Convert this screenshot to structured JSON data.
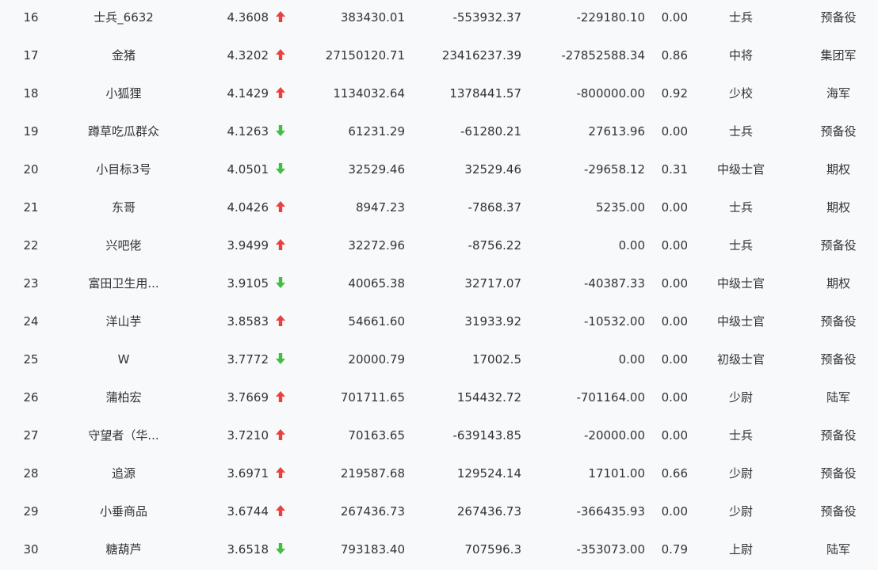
{
  "colors": {
    "up": "#e8423f",
    "down": "#3fbf3f",
    "text": "#333333",
    "background": "#f8f9fb"
  },
  "rows": [
    {
      "rank": "16",
      "name": "士兵_6632",
      "score": "4.3608",
      "trend": "up",
      "v1": "383430.01",
      "v2": "-553932.37",
      "v3": "-229180.10",
      "ratio": "0.00",
      "level": "士兵",
      "category": "预备役"
    },
    {
      "rank": "17",
      "name": "金猪",
      "score": "4.3202",
      "trend": "up",
      "v1": "27150120.71",
      "v2": "23416237.39",
      "v3": "-27852588.34",
      "ratio": "0.86",
      "level": "中将",
      "category": "集团军"
    },
    {
      "rank": "18",
      "name": "小狐狸",
      "score": "4.1429",
      "trend": "up",
      "v1": "1134032.64",
      "v2": "1378441.57",
      "v3": "-800000.00",
      "ratio": "0.92",
      "level": "少校",
      "category": "海军"
    },
    {
      "rank": "19",
      "name": "蹲草吃瓜群众",
      "score": "4.1263",
      "trend": "down",
      "v1": "61231.29",
      "v2": "-61280.21",
      "v3": "27613.96",
      "ratio": "0.00",
      "level": "士兵",
      "category": "预备役"
    },
    {
      "rank": "20",
      "name": "小目标3号",
      "score": "4.0501",
      "trend": "down",
      "v1": "32529.46",
      "v2": "32529.46",
      "v3": "-29658.12",
      "ratio": "0.31",
      "level": "中级士官",
      "category": "期权"
    },
    {
      "rank": "21",
      "name": "东哥",
      "score": "4.0426",
      "trend": "up",
      "v1": "8947.23",
      "v2": "-7868.37",
      "v3": "5235.00",
      "ratio": "0.00",
      "level": "士兵",
      "category": "期权"
    },
    {
      "rank": "22",
      "name": "兴吧佬",
      "score": "3.9499",
      "trend": "up",
      "v1": "32272.96",
      "v2": "-8756.22",
      "v3": "0.00",
      "ratio": "0.00",
      "level": "士兵",
      "category": "预备役"
    },
    {
      "rank": "23",
      "name": "富田卫生用...",
      "score": "3.9105",
      "trend": "down",
      "v1": "40065.38",
      "v2": "32717.07",
      "v3": "-40387.33",
      "ratio": "0.00",
      "level": "中级士官",
      "category": "期权"
    },
    {
      "rank": "24",
      "name": "洋山芋",
      "score": "3.8583",
      "trend": "up",
      "v1": "54661.60",
      "v2": "31933.92",
      "v3": "-10532.00",
      "ratio": "0.00",
      "level": "中级士官",
      "category": "预备役"
    },
    {
      "rank": "25",
      "name": "W",
      "score": "3.7772",
      "trend": "down",
      "v1": "20000.79",
      "v2": "17002.5",
      "v3": "0.00",
      "ratio": "0.00",
      "level": "初级士官",
      "category": "预备役"
    },
    {
      "rank": "26",
      "name": "蒲柏宏",
      "score": "3.7669",
      "trend": "up",
      "v1": "701711.65",
      "v2": "154432.72",
      "v3": "-701164.00",
      "ratio": "0.00",
      "level": "少尉",
      "category": "陆军"
    },
    {
      "rank": "27",
      "name": "守望者（华...",
      "score": "3.7210",
      "trend": "up",
      "v1": "70163.65",
      "v2": "-639143.85",
      "v3": "-20000.00",
      "ratio": "0.00",
      "level": "士兵",
      "category": "预备役"
    },
    {
      "rank": "28",
      "name": "追源",
      "score": "3.6971",
      "trend": "up",
      "v1": "219587.68",
      "v2": "129524.14",
      "v3": "17101.00",
      "ratio": "0.66",
      "level": "少尉",
      "category": "预备役"
    },
    {
      "rank": "29",
      "name": "小垂商品",
      "score": "3.6744",
      "trend": "up",
      "v1": "267436.73",
      "v2": "267436.73",
      "v3": "-366435.93",
      "ratio": "0.00",
      "level": "少尉",
      "category": "预备役"
    },
    {
      "rank": "30",
      "name": "糖葫芦",
      "score": "3.6518",
      "trend": "down",
      "v1": "793183.40",
      "v2": "707596.3",
      "v3": "-353073.00",
      "ratio": "0.79",
      "level": "上尉",
      "category": "陆军"
    }
  ]
}
